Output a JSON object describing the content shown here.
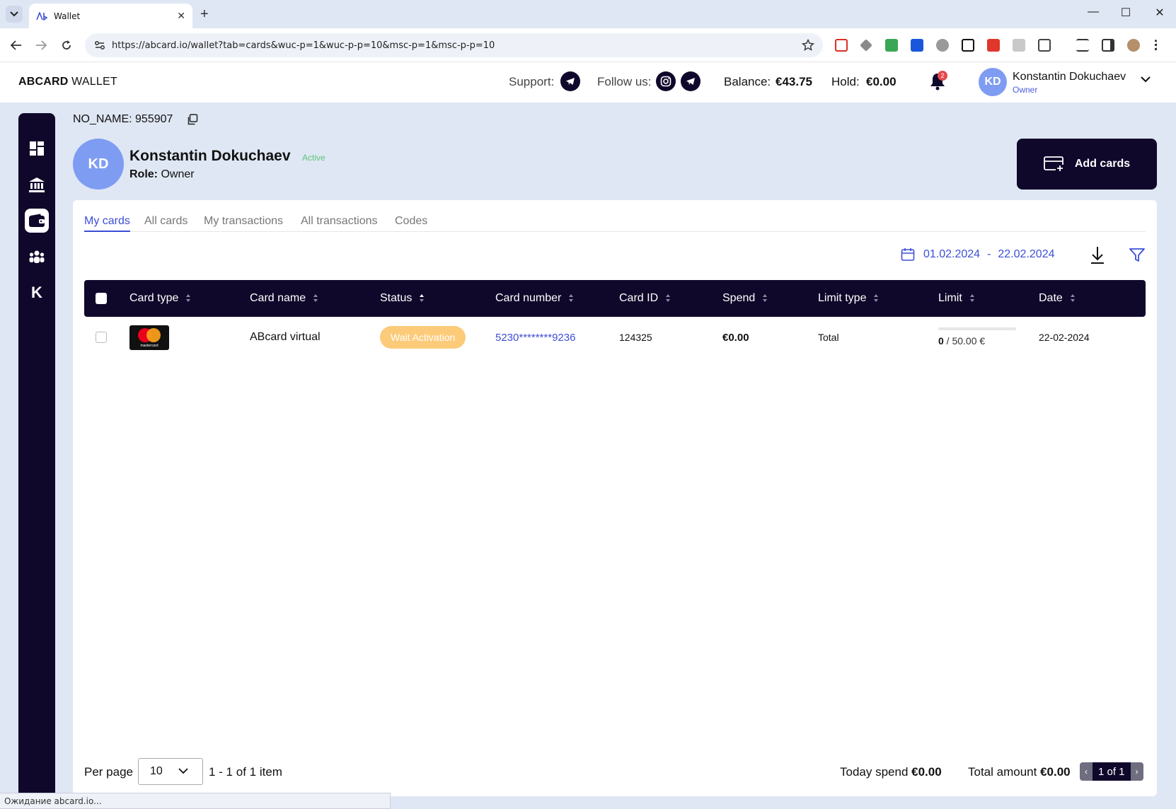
{
  "browser": {
    "tab_title": "Wallet",
    "tab_close": "✕",
    "new_tab": "+",
    "url": "https://abcard.io/wallet?tab=cards&wuc-p=1&wuc-p-p=10&msc-p=1&msc-p-p=10",
    "window_controls": {
      "minimize": "—",
      "maximize": "☐",
      "close": "✕"
    },
    "status_text": "Ожидание abcard.io..."
  },
  "header": {
    "logo_bold": "ABCARD",
    "logo_light": " WALLET",
    "support_label": "Support:",
    "follow_label": "Follow us:",
    "balance_label": "Balance:",
    "balance_value": "€43.75",
    "hold_label": "Hold:",
    "hold_value": "€0.00",
    "notifications_count": "2",
    "user_initials": "KD",
    "user_name": "Konstantin Dokuchaev",
    "user_role": "Owner"
  },
  "sidebar": {
    "items": [
      {
        "icon": "dashboard-icon"
      },
      {
        "icon": "bank-icon"
      },
      {
        "icon": "wallet-icon",
        "active": true
      },
      {
        "icon": "team-icon"
      },
      {
        "icon": "k-logo-icon",
        "label": "K"
      }
    ]
  },
  "account": {
    "title": "NO_NAME: 955907",
    "initials": "KD",
    "name": "Konstantin Dokuchaev",
    "status": "Active",
    "role_label": "Role:",
    "role_value": "Owner",
    "add_cards_label": "Add cards"
  },
  "tabs": [
    {
      "label": "My cards",
      "active": true
    },
    {
      "label": "All cards"
    },
    {
      "label": "My transactions"
    },
    {
      "label": "All transactions"
    },
    {
      "label": "Codes"
    }
  ],
  "filters": {
    "date_from": "01.02.2024",
    "date_separator": "-",
    "date_to": "22.02.2024"
  },
  "table": {
    "columns": [
      "Card type",
      "Card name",
      "Status",
      "Card number",
      "Card ID",
      "Spend",
      "Limit type",
      "Limit",
      "Date"
    ],
    "rows": [
      {
        "card_type": "mastercard",
        "card_name": "ABcard virtual",
        "status": "Wait Activation",
        "card_number": "5230********9236",
        "card_id": "124325",
        "spend": "€0.00",
        "limit_type": "Total",
        "limit_used": "0",
        "limit_total": " / 50.00 €",
        "limit_fraction": 0,
        "date": "22-02-2024"
      }
    ]
  },
  "footer": {
    "per_page_label": "Per page",
    "per_page_value": "10",
    "range_text": "1 - 1 of 1 item",
    "today_spend_label": "Today spend ",
    "today_spend_value": "€0.00",
    "total_amount_label": "Total amount ",
    "total_amount_value": "€0.00",
    "pager_text": "1 of 1"
  },
  "colors": {
    "primary_dark": "#10082b",
    "accent_blue": "#3d4ed6",
    "status_pending": "#fccb7a",
    "status_active": "#5ac47a",
    "avatar": "#7e9cf2"
  }
}
